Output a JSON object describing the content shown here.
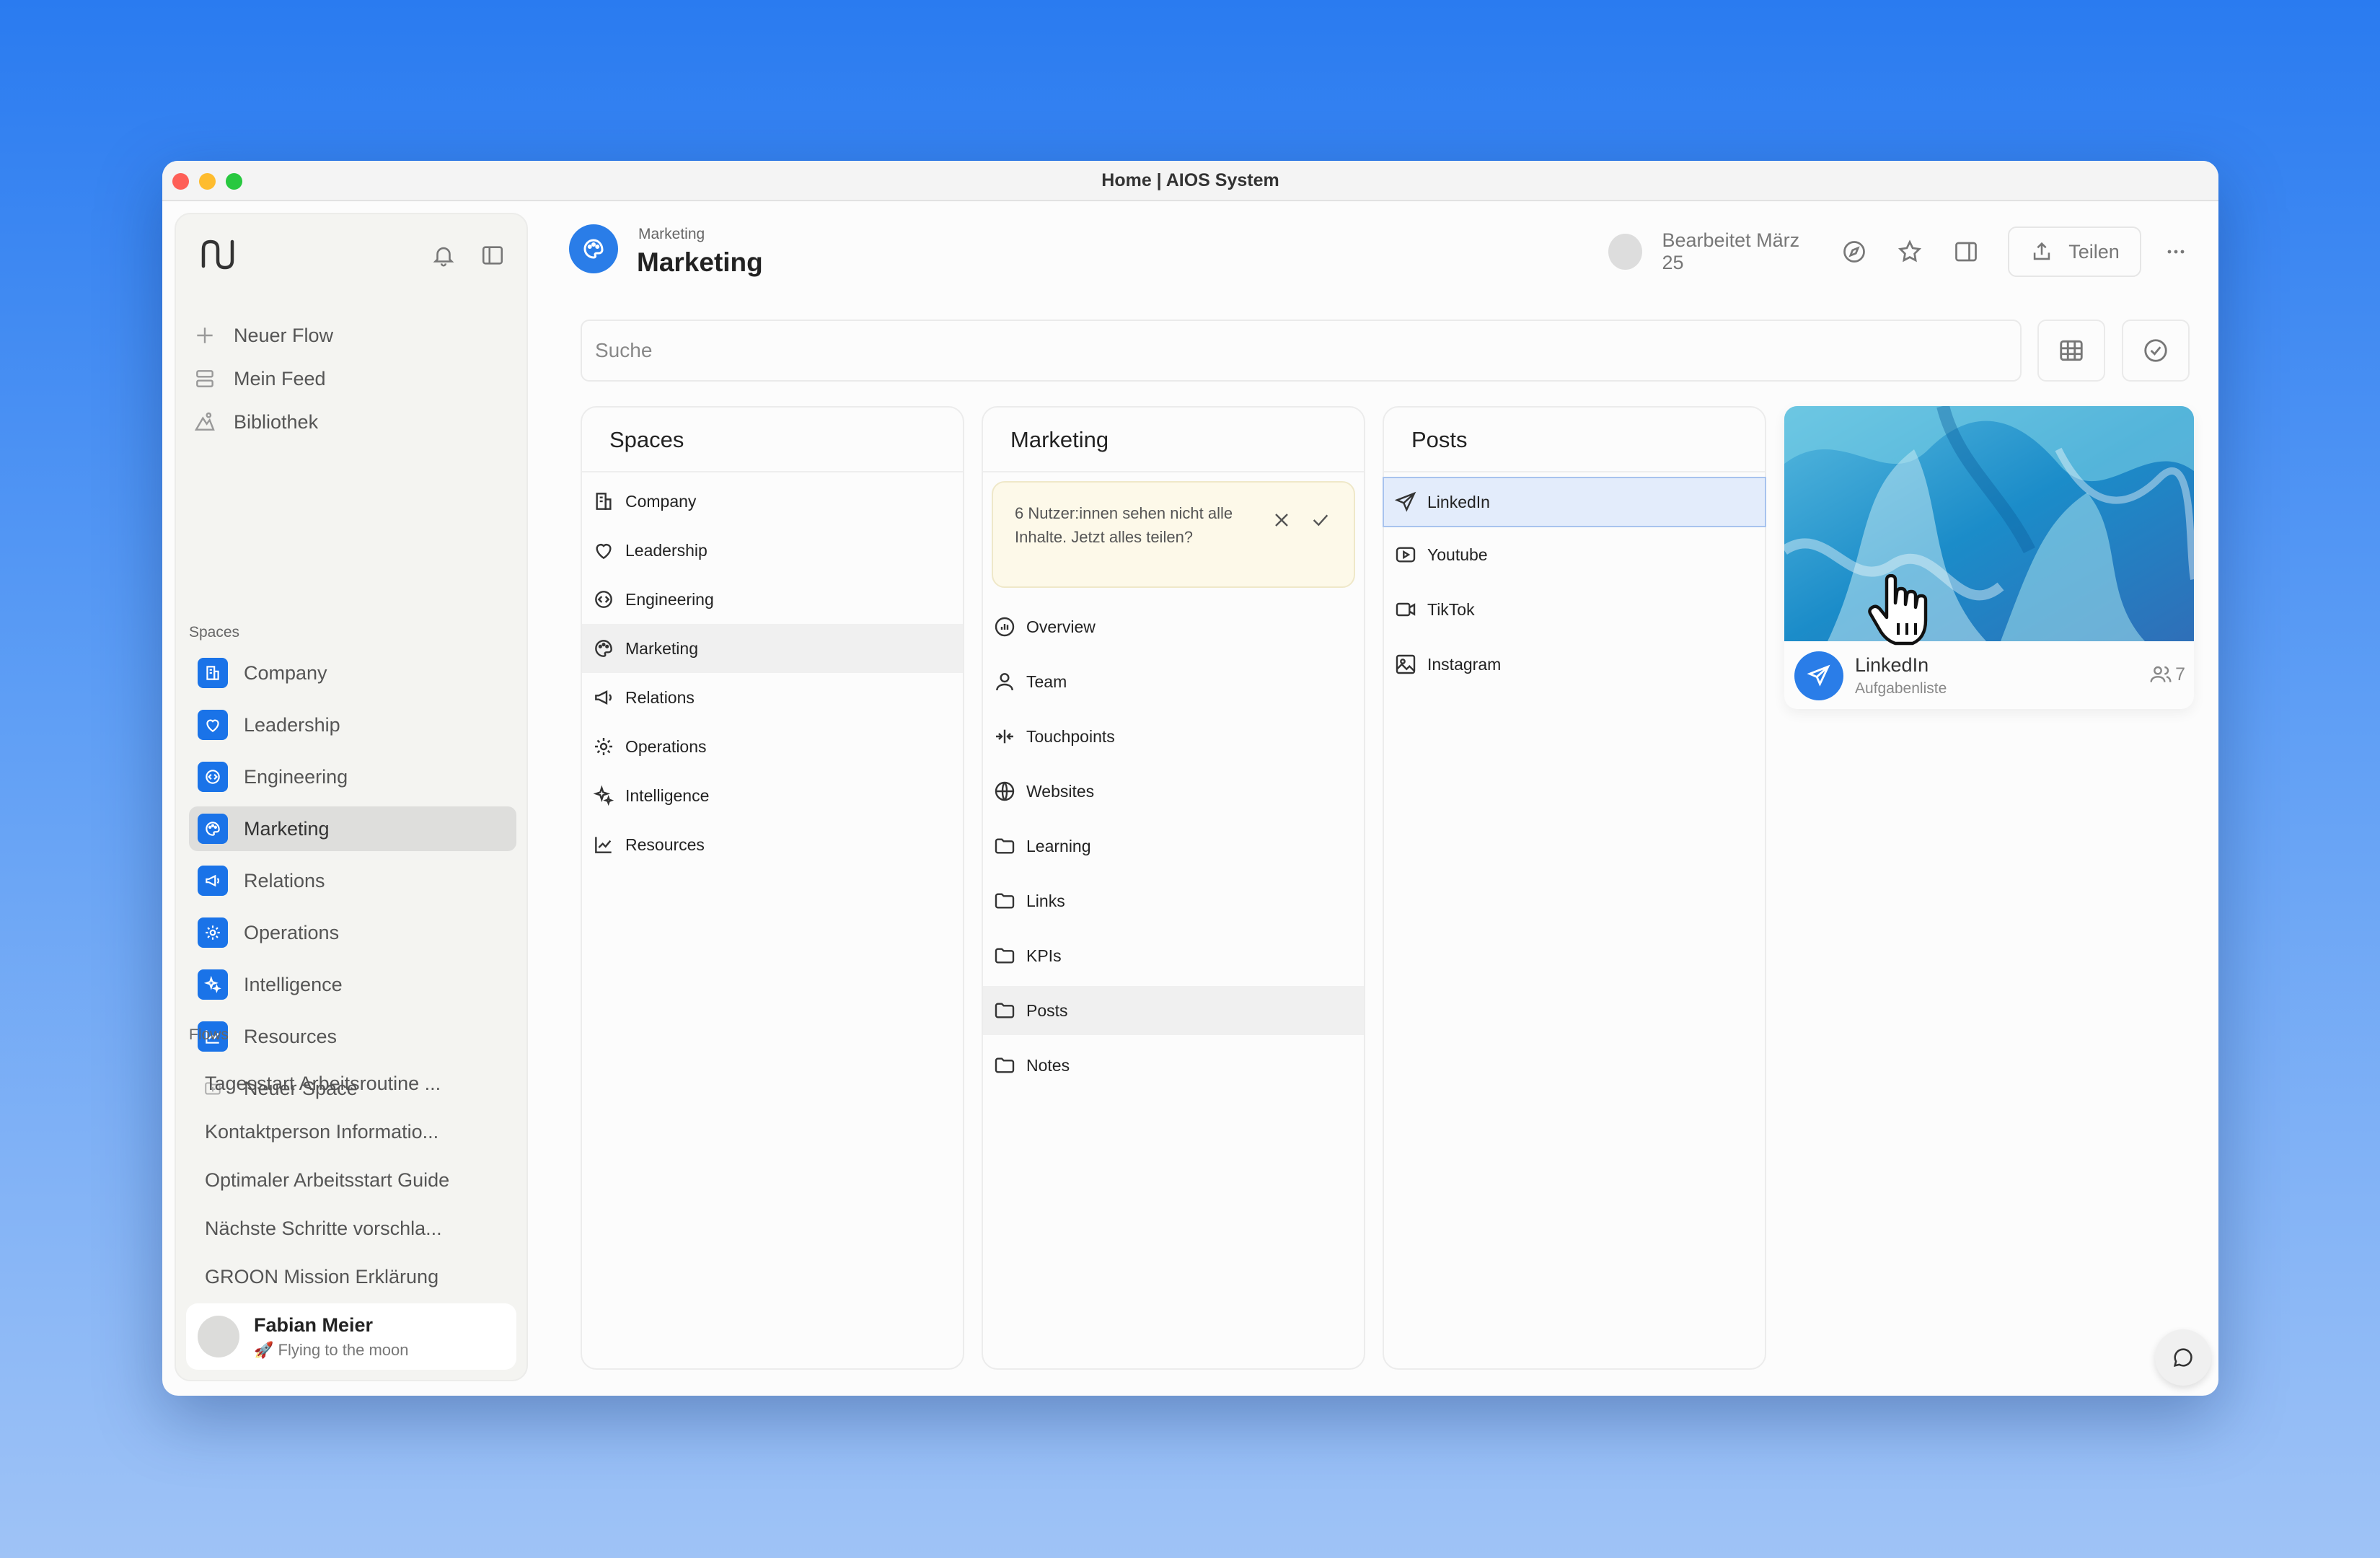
{
  "window": {
    "title": "Home | AIOS System"
  },
  "sidebar": {
    "nav": [
      {
        "label": "Neuer Flow",
        "icon": "plus-icon"
      },
      {
        "label": "Mein Feed",
        "icon": "feed-icon"
      },
      {
        "label": "Bibliothek",
        "icon": "library-icon"
      }
    ],
    "spaces_heading": "Spaces",
    "spaces": [
      {
        "label": "Company",
        "icon": "building-icon"
      },
      {
        "label": "Leadership",
        "icon": "heart-icon"
      },
      {
        "label": "Engineering",
        "icon": "code-icon"
      },
      {
        "label": "Marketing",
        "icon": "palette-icon",
        "active": true
      },
      {
        "label": "Relations",
        "icon": "megaphone-icon"
      },
      {
        "label": "Operations",
        "icon": "gear-icon"
      },
      {
        "label": "Intelligence",
        "icon": "sparkle-icon"
      },
      {
        "label": "Resources",
        "icon": "chart-icon"
      },
      {
        "label": "Neuer Space",
        "icon": "folder-plus-icon"
      }
    ],
    "flows_heading": "Flows",
    "flows": [
      "Tagesstart Arbeitsroutine ...",
      "Kontaktperson Informatio...",
      "Optimaler Arbeitsstart Guide",
      "Nächste Schritte vorschla...",
      "GROON Mission Erklärung"
    ],
    "user": {
      "name": "Fabian Meier",
      "status": "🚀 Flying to the moon"
    }
  },
  "header": {
    "breadcrumb": "Marketing",
    "title": "Marketing",
    "edited": "Bearbeitet März 25",
    "share_label": "Teilen"
  },
  "search": {
    "placeholder": "Suche"
  },
  "columns": {
    "spaces": {
      "title": "Spaces",
      "items": [
        "Company",
        "Leadership",
        "Engineering",
        "Marketing",
        "Relations",
        "Operations",
        "Intelligence",
        "Resources"
      ],
      "active": "Marketing"
    },
    "marketing": {
      "title": "Marketing",
      "notice": "6 Nutzer:innen sehen nicht alle Inhalte. Jetzt alles teilen?",
      "items": [
        "Overview",
        "Team",
        "Touchpoints",
        "Websites",
        "Learning",
        "Links",
        "KPIs",
        "Posts",
        "Notes"
      ],
      "active": "Posts"
    },
    "posts": {
      "title": "Posts",
      "items": [
        "LinkedIn",
        "Youtube",
        "TikTok",
        "Instagram"
      ],
      "selected": "LinkedIn"
    }
  },
  "card": {
    "title": "LinkedIn",
    "subtitle": "Aufgabenliste",
    "members": "7"
  },
  "colors": {
    "accent": "#1a73e8",
    "notice_bg": "#fdf9e9",
    "selected_bg": "#e3ecfb"
  }
}
